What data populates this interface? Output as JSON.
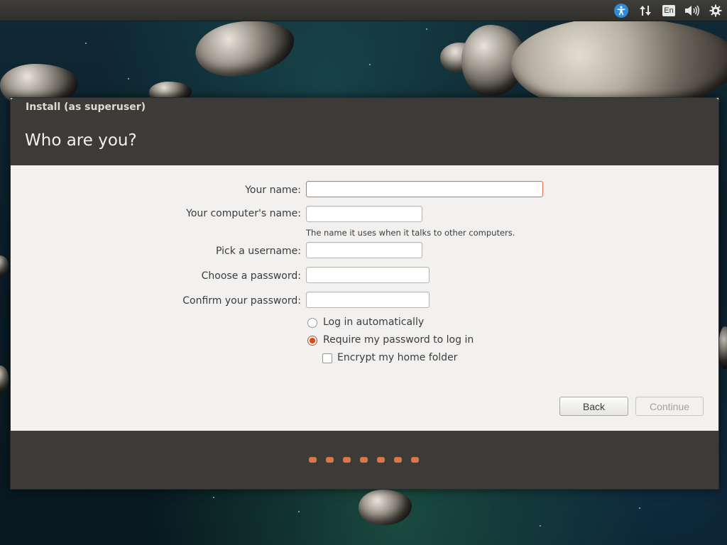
{
  "panel": {
    "indicators": [
      {
        "name": "accessibility-icon"
      },
      {
        "name": "network-icon"
      },
      {
        "name": "keyboard-layout-icon",
        "label": "En"
      },
      {
        "name": "volume-icon"
      },
      {
        "name": "settings-gear-icon"
      }
    ]
  },
  "window": {
    "title": "Install (as superuser)",
    "heading": "Who are you?"
  },
  "form": {
    "name_label": "Your name:",
    "name_value": "",
    "computer_label": "Your computer's name:",
    "computer_value": "",
    "computer_hint": "The name it uses when it talks to other computers.",
    "username_label": "Pick a username:",
    "username_value": "",
    "password_label": "Choose a password:",
    "password_value": "",
    "confirm_label": "Confirm your password:",
    "confirm_value": "",
    "login_auto_label": "Log in automatically",
    "login_auto_checked": false,
    "require_password_label": "Require my password to log in",
    "require_password_checked": true,
    "encrypt_label": "Encrypt my home folder",
    "encrypt_checked": false
  },
  "buttons": {
    "back": "Back",
    "continue": "Continue"
  },
  "progress": {
    "steps_total": 7
  },
  "colors": {
    "accent": "#dd4814",
    "header_bg": "#3c3b37",
    "body_bg": "#f2f1f0",
    "progress_dot": "#dd7548"
  }
}
